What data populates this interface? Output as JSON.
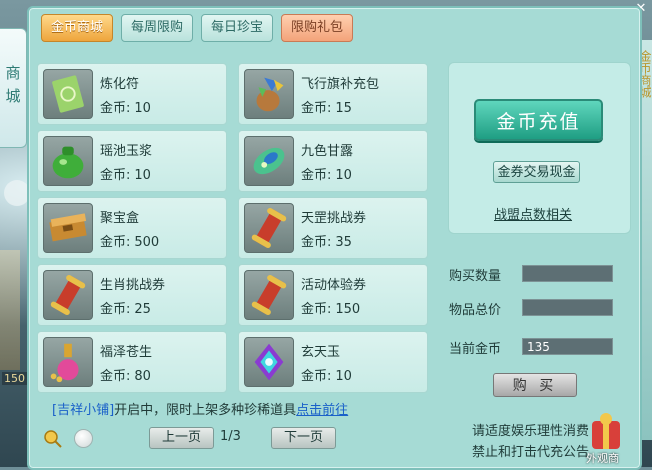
{
  "window": {
    "side_title": "商城",
    "right_edge_text": "金币商城",
    "right_edge_text2": "积分商城",
    "top_right_text": "",
    "close_glyph": "✕",
    "left_badge": "150"
  },
  "tabs": [
    {
      "label": "金币商城",
      "active": true
    },
    {
      "label": "每周限购",
      "active": false
    },
    {
      "label": "每日珍宝",
      "active": false
    },
    {
      "label": "限购礼包",
      "active": false
    }
  ],
  "price_label": "金币:",
  "items": [
    {
      "name": "炼化符",
      "price": "10",
      "icon": "talisman-icon"
    },
    {
      "name": "飞行旗补充包",
      "price": "15",
      "icon": "flag-bag-icon"
    },
    {
      "name": "瑶池玉浆",
      "price": "10",
      "icon": "jade-pot-icon"
    },
    {
      "name": "九色甘露",
      "price": "10",
      "icon": "leaf-gem-icon"
    },
    {
      "name": "聚宝盒",
      "price": "500",
      "icon": "treasure-box-icon"
    },
    {
      "name": "天罡挑战券",
      "price": "35",
      "icon": "scroll-icon"
    },
    {
      "name": "生肖挑战券",
      "price": "25",
      "icon": "scroll-icon"
    },
    {
      "name": "活动体验券",
      "price": "150",
      "icon": "scroll-icon"
    },
    {
      "name": "福泽苍生",
      "price": "80",
      "icon": "gourd-icon"
    },
    {
      "name": "玄天玉",
      "price": "10",
      "icon": "jade-crystal-icon"
    }
  ],
  "notice": {
    "shop": "[吉祥小铺]",
    "text": "开启中，限时上架多种珍稀道具",
    "link": "点击前往"
  },
  "pager": {
    "prev": "上一页",
    "page": "1/3",
    "next": "下一页"
  },
  "right": {
    "recharge": "金币充值",
    "exchange": "金券交易现金",
    "alliance": "战盟点数相关",
    "qty_label": "购买数量",
    "qty_value": "",
    "total_label": "物品总价",
    "total_value": "",
    "current_label": "当前金币",
    "current_value": "135",
    "buy": "购 买"
  },
  "disclaimer": {
    "line1": "请适度娱乐理性消费",
    "line2": "禁止和打击代充公告"
  },
  "gift_label": "外观商"
}
